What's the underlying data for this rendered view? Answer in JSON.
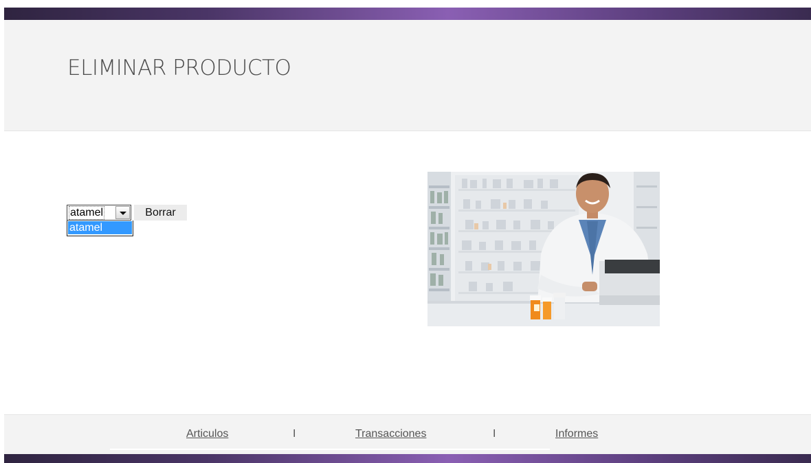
{
  "header": {
    "title": "ELIMINAR PRODUCTO"
  },
  "form": {
    "select_value": "atamel",
    "options": [
      "atamel"
    ],
    "delete_button_label": "Borrar"
  },
  "image": {
    "alt": "pharmacist-at-counter"
  },
  "footer": {
    "links": [
      {
        "label": "Articulos"
      },
      {
        "label": "Transacciones"
      },
      {
        "label": "Informes"
      }
    ],
    "separator": "I"
  },
  "colors": {
    "accent_bar": "#8a5fb3",
    "header_bg": "#f3f3f3",
    "selected_option": "#3399ff"
  }
}
